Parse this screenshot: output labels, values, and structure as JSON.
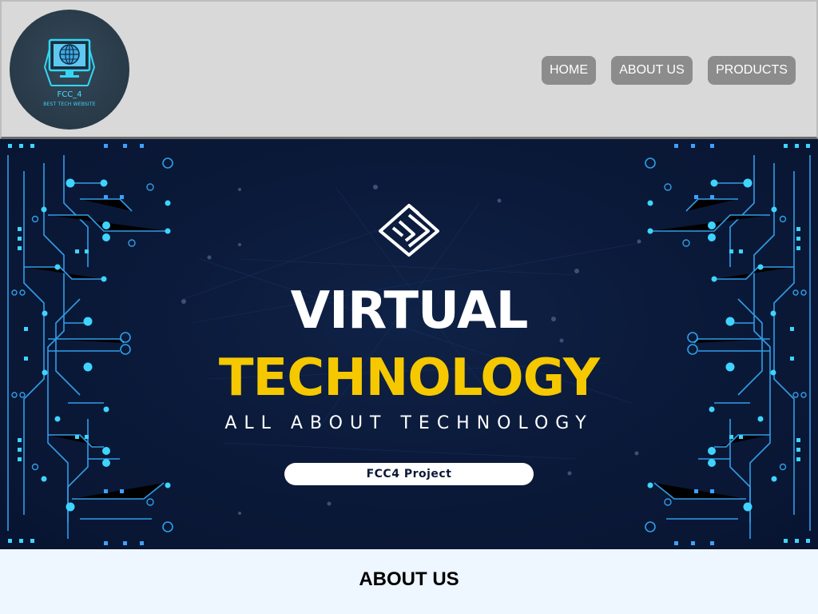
{
  "header": {
    "logo": {
      "title": "FCC_4",
      "subtitle": "BEST TECH WEBSITE",
      "icon": "monitor-globe-icon"
    },
    "nav": [
      {
        "label": "HOME"
      },
      {
        "label": "ABOUT US"
      },
      {
        "label": "PRODUCTS"
      }
    ]
  },
  "hero": {
    "icon": "circuit-chip-icon",
    "title_line1": "VIRTUAL",
    "title_line2": "TECHNOLOGY",
    "subtitle": "ALL ABOUT TECHNOLOGY",
    "badge": "FCC4 Project",
    "colors": {
      "background": "#0b1a3a",
      "circuit": "#2fb6ff",
      "accent": "#f5c800"
    }
  },
  "about": {
    "title": "ABOUT US"
  }
}
